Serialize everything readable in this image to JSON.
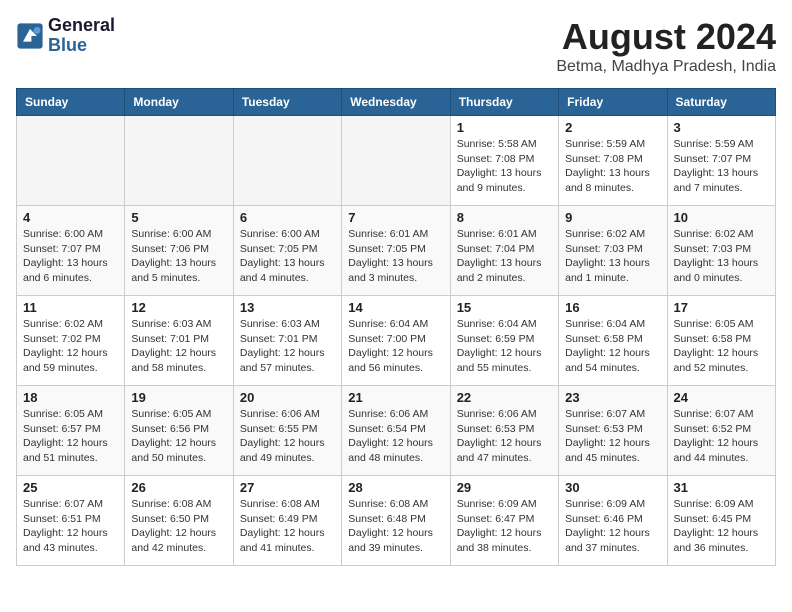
{
  "header": {
    "logo_line1": "General",
    "logo_line2": "Blue",
    "month_title": "August 2024",
    "subtitle": "Betma, Madhya Pradesh, India"
  },
  "days_of_week": [
    "Sunday",
    "Monday",
    "Tuesday",
    "Wednesday",
    "Thursday",
    "Friday",
    "Saturday"
  ],
  "weeks": [
    [
      {
        "day": "",
        "empty": true
      },
      {
        "day": "",
        "empty": true
      },
      {
        "day": "",
        "empty": true
      },
      {
        "day": "",
        "empty": true
      },
      {
        "day": "1",
        "sunrise": "5:58 AM",
        "sunset": "7:08 PM",
        "daylight": "13 hours and 9 minutes."
      },
      {
        "day": "2",
        "sunrise": "5:59 AM",
        "sunset": "7:08 PM",
        "daylight": "13 hours and 8 minutes."
      },
      {
        "day": "3",
        "sunrise": "5:59 AM",
        "sunset": "7:07 PM",
        "daylight": "13 hours and 7 minutes."
      }
    ],
    [
      {
        "day": "4",
        "sunrise": "6:00 AM",
        "sunset": "7:07 PM",
        "daylight": "13 hours and 6 minutes."
      },
      {
        "day": "5",
        "sunrise": "6:00 AM",
        "sunset": "7:06 PM",
        "daylight": "13 hours and 5 minutes."
      },
      {
        "day": "6",
        "sunrise": "6:00 AM",
        "sunset": "7:05 PM",
        "daylight": "13 hours and 4 minutes."
      },
      {
        "day": "7",
        "sunrise": "6:01 AM",
        "sunset": "7:05 PM",
        "daylight": "13 hours and 3 minutes."
      },
      {
        "day": "8",
        "sunrise": "6:01 AM",
        "sunset": "7:04 PM",
        "daylight": "13 hours and 2 minutes."
      },
      {
        "day": "9",
        "sunrise": "6:02 AM",
        "sunset": "7:03 PM",
        "daylight": "13 hours and 1 minute."
      },
      {
        "day": "10",
        "sunrise": "6:02 AM",
        "sunset": "7:03 PM",
        "daylight": "13 hours and 0 minutes."
      }
    ],
    [
      {
        "day": "11",
        "sunrise": "6:02 AM",
        "sunset": "7:02 PM",
        "daylight": "12 hours and 59 minutes."
      },
      {
        "day": "12",
        "sunrise": "6:03 AM",
        "sunset": "7:01 PM",
        "daylight": "12 hours and 58 minutes."
      },
      {
        "day": "13",
        "sunrise": "6:03 AM",
        "sunset": "7:01 PM",
        "daylight": "12 hours and 57 minutes."
      },
      {
        "day": "14",
        "sunrise": "6:04 AM",
        "sunset": "7:00 PM",
        "daylight": "12 hours and 56 minutes."
      },
      {
        "day": "15",
        "sunrise": "6:04 AM",
        "sunset": "6:59 PM",
        "daylight": "12 hours and 55 minutes."
      },
      {
        "day": "16",
        "sunrise": "6:04 AM",
        "sunset": "6:58 PM",
        "daylight": "12 hours and 54 minutes."
      },
      {
        "day": "17",
        "sunrise": "6:05 AM",
        "sunset": "6:58 PM",
        "daylight": "12 hours and 52 minutes."
      }
    ],
    [
      {
        "day": "18",
        "sunrise": "6:05 AM",
        "sunset": "6:57 PM",
        "daylight": "12 hours and 51 minutes."
      },
      {
        "day": "19",
        "sunrise": "6:05 AM",
        "sunset": "6:56 PM",
        "daylight": "12 hours and 50 minutes."
      },
      {
        "day": "20",
        "sunrise": "6:06 AM",
        "sunset": "6:55 PM",
        "daylight": "12 hours and 49 minutes."
      },
      {
        "day": "21",
        "sunrise": "6:06 AM",
        "sunset": "6:54 PM",
        "daylight": "12 hours and 48 minutes."
      },
      {
        "day": "22",
        "sunrise": "6:06 AM",
        "sunset": "6:53 PM",
        "daylight": "12 hours and 47 minutes."
      },
      {
        "day": "23",
        "sunrise": "6:07 AM",
        "sunset": "6:53 PM",
        "daylight": "12 hours and 45 minutes."
      },
      {
        "day": "24",
        "sunrise": "6:07 AM",
        "sunset": "6:52 PM",
        "daylight": "12 hours and 44 minutes."
      }
    ],
    [
      {
        "day": "25",
        "sunrise": "6:07 AM",
        "sunset": "6:51 PM",
        "daylight": "12 hours and 43 minutes."
      },
      {
        "day": "26",
        "sunrise": "6:08 AM",
        "sunset": "6:50 PM",
        "daylight": "12 hours and 42 minutes."
      },
      {
        "day": "27",
        "sunrise": "6:08 AM",
        "sunset": "6:49 PM",
        "daylight": "12 hours and 41 minutes."
      },
      {
        "day": "28",
        "sunrise": "6:08 AM",
        "sunset": "6:48 PM",
        "daylight": "12 hours and 39 minutes."
      },
      {
        "day": "29",
        "sunrise": "6:09 AM",
        "sunset": "6:47 PM",
        "daylight": "12 hours and 38 minutes."
      },
      {
        "day": "30",
        "sunrise": "6:09 AM",
        "sunset": "6:46 PM",
        "daylight": "12 hours and 37 minutes."
      },
      {
        "day": "31",
        "sunrise": "6:09 AM",
        "sunset": "6:45 PM",
        "daylight": "12 hours and 36 minutes."
      }
    ]
  ]
}
